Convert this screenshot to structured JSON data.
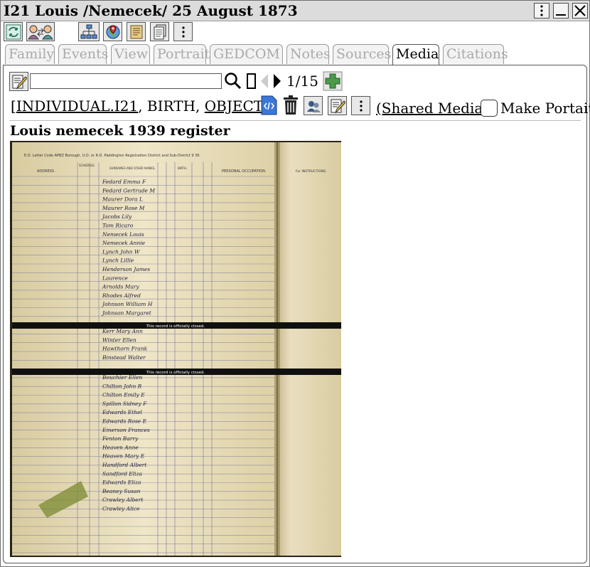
{
  "window": {
    "title": "I21 Louis /Nemecek/ 25 August 1873",
    "controls": [
      "menu-icon",
      "minimize-icon",
      "close-icon"
    ]
  },
  "toolbar": {
    "buttons": [
      {
        "name": "change-object-button",
        "icon": "refresh-icon"
      },
      {
        "name": "relationship-button",
        "icon": "persons-link-icon"
      },
      {
        "name": "family-tree-button",
        "icon": "tree-chart-icon"
      },
      {
        "name": "map-button",
        "icon": "map-pin-icon"
      },
      {
        "name": "notes-button",
        "icon": "scroll-icon"
      },
      {
        "name": "report-button",
        "icon": "documents-icon"
      },
      {
        "name": "more-button",
        "icon": "kebab-icon"
      }
    ]
  },
  "tabs": [
    {
      "label": "Family",
      "active": false
    },
    {
      "label": "Events",
      "active": false
    },
    {
      "label": "View",
      "active": false
    },
    {
      "label": "Portrait",
      "active": false
    },
    {
      "label": "GEDCOM",
      "active": false
    },
    {
      "label": "Notes",
      "active": false
    },
    {
      "label": "Sources",
      "active": false
    },
    {
      "label": "Media",
      "active": true
    },
    {
      "label": "Citations",
      "active": false
    }
  ],
  "media_nav": {
    "search_value": "",
    "page_count": "1/15"
  },
  "reference": {
    "open_bracket": "[",
    "individual_link": "INDIVIDUAL.I21",
    "comma1": ", ",
    "event": "BIRTH",
    "comma2": ", ",
    "object_link": "OBJECT",
    "close_bracket": "]",
    "shared_media_link": "(Shared Media)",
    "make_portrait_label": "Make Portait",
    "make_portrait_checked": false
  },
  "media": {
    "caption": "Louis nemecek 1939 register",
    "closed_notice_1": "This record is officially closed.",
    "closed_notice_2": "This record is officially closed.",
    "register_header": "E.D. Letter Code  APBZ  Borough, U.D. or R.D.  Paddington  Registration District and Sub-District  9  36",
    "col_address": "ADDRESS.",
    "col_schedule": "SCHEDULE.",
    "col_surnames": "SURNAMES AND OTHER NAMES.",
    "col_birth": "BIRTH.",
    "col_occupation": "PERSONAL OCCUPATION.",
    "col_instructions": "For INSTRUCTIONS.",
    "row_names": [
      "Fedard Emma F",
      "Fedard Gertrude M",
      "Maurer Dora L",
      "Maurer Rose M",
      "Jacobs Lily",
      "Tom Ricaro",
      "Nemecek Louis",
      "Nemecek Annie",
      "Lynch John W",
      "Lynch Lillie",
      "Henderson James",
      "Laurence",
      "Arnolds Mary",
      "Rhodes Alfred",
      "Johnson William H",
      "Johnson Margaret",
      "Kerr Mary Ann",
      "Winter Ellen",
      "Hawthorn Frank",
      "Binstead Walter",
      "Bouchier Ellen",
      "Chilton John R",
      "Chilton Emily E",
      "Spillon Sidney F",
      "Edwards Ethel",
      "Edwards Rose E",
      "Emerson Frances",
      "Fenton Barry",
      "Heaven Anne",
      "Heaven Mary E",
      "Handford Albert",
      "Sandford Eliza",
      "Edwards Eliza",
      "Beaney Susan",
      "Crawley Albert",
      "Crawley Alice"
    ]
  },
  "colors": {
    "tab_inactive_text": "#aaaaaa",
    "titlebar_bg": "#dcdcdc",
    "add_button": "#4a9a4a",
    "paper": "#ece2c4",
    "closed_band": "#101010"
  }
}
